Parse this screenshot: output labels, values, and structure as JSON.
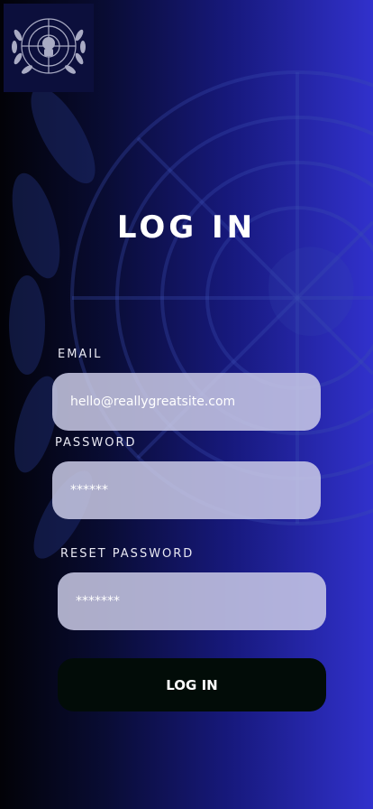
{
  "title": "LOG IN",
  "form": {
    "email": {
      "label": "EMAIL",
      "value": "hello@reallygreatsite.com"
    },
    "password": {
      "label": "PASSWORD",
      "value": "******"
    },
    "reset_password": {
      "label": "RESET PASSWORD",
      "value": "*******"
    },
    "submit_label": "LOG IN"
  },
  "colors": {
    "background_start": "#020207",
    "background_end": "#3131cc",
    "field_fill": "#cdcde8",
    "button_fill": "#020c08",
    "text": "#ffffff"
  },
  "icons": [
    "emblem-logo-icon",
    "background-emblem-icon"
  ]
}
